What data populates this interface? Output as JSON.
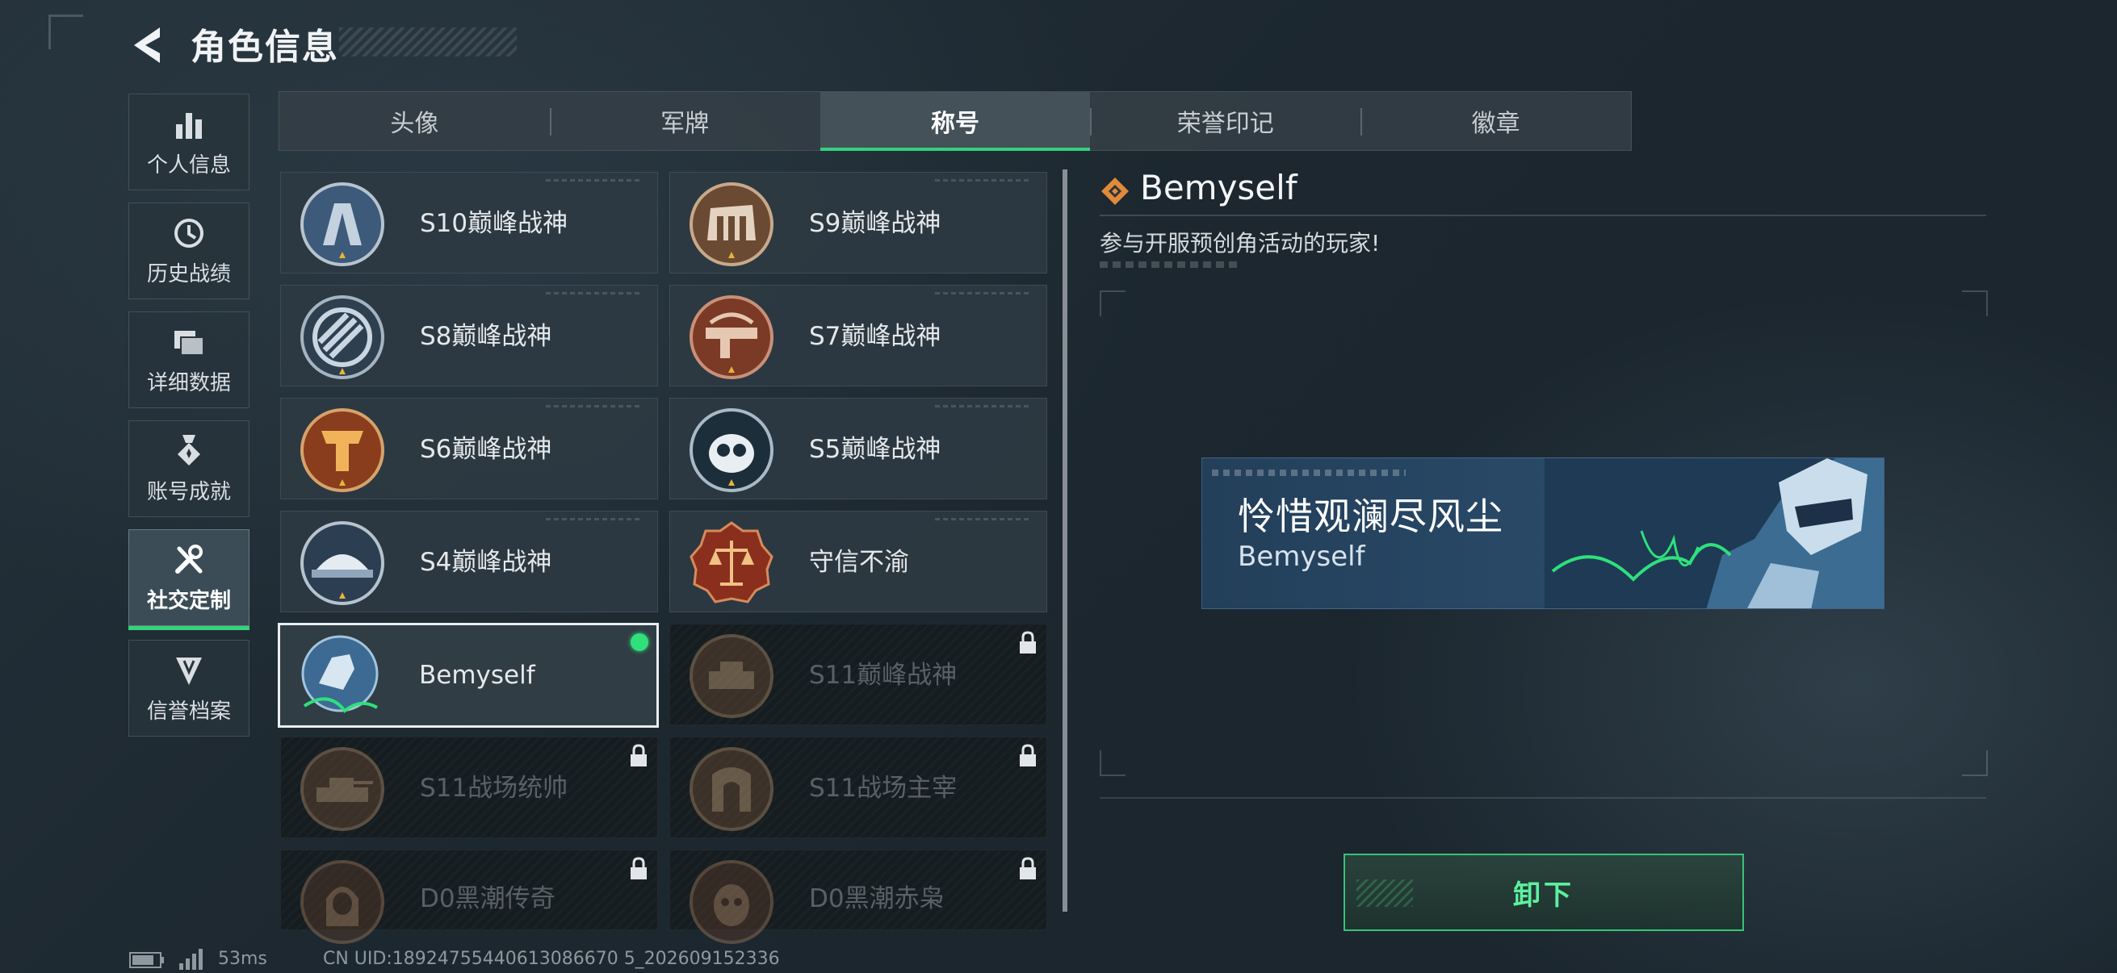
{
  "header": {
    "title": "角色信息"
  },
  "sidebar": {
    "items": [
      {
        "label": "个人信息",
        "icon": "bar-chart-icon",
        "active": false
      },
      {
        "label": "历史战绩",
        "icon": "clock-history-icon",
        "active": false
      },
      {
        "label": "详细数据",
        "icon": "folder-icon",
        "active": false
      },
      {
        "label": "账号成就",
        "icon": "medal-icon",
        "active": false
      },
      {
        "label": "社交定制",
        "icon": "tools-icon",
        "active": true
      },
      {
        "label": "信誉档案",
        "icon": "shield-icon",
        "active": false
      }
    ]
  },
  "tabs": [
    {
      "label": "头像",
      "active": false
    },
    {
      "label": "军牌",
      "active": false
    },
    {
      "label": "称号",
      "active": true
    },
    {
      "label": "荣誉印记",
      "active": false
    },
    {
      "label": "徽章",
      "active": false
    }
  ],
  "titles": [
    {
      "label": "S10巅峰战神",
      "icon": "s10-peak-badge-icon",
      "locked": false,
      "equipped": false
    },
    {
      "label": "S9巅峰战神",
      "icon": "s9-peak-badge-icon",
      "locked": false,
      "equipped": false
    },
    {
      "label": "S8巅峰战神",
      "icon": "s8-peak-badge-icon",
      "locked": false,
      "equipped": false
    },
    {
      "label": "S7巅峰战神",
      "icon": "s7-peak-badge-icon",
      "locked": false,
      "equipped": false
    },
    {
      "label": "S6巅峰战神",
      "icon": "s6-peak-badge-icon",
      "locked": false,
      "equipped": false
    },
    {
      "label": "S5巅峰战神",
      "icon": "s5-peak-badge-icon",
      "locked": false,
      "equipped": false
    },
    {
      "label": "S4巅峰战神",
      "icon": "s4-peak-badge-icon",
      "locked": false,
      "equipped": false
    },
    {
      "label": "守信不渝",
      "icon": "scales-badge-icon",
      "locked": false,
      "equipped": false
    },
    {
      "label": "Bemyself",
      "icon": "bemyself-badge-icon",
      "locked": false,
      "equipped": true
    },
    {
      "label": "S11巅峰战神",
      "icon": "s11-peak-badge-icon",
      "locked": true,
      "equipped": false
    },
    {
      "label": "S11战场统帅",
      "icon": "s11-commander-badge-icon",
      "locked": true,
      "equipped": false
    },
    {
      "label": "S11战场主宰",
      "icon": "s11-dominator-badge-icon",
      "locked": true,
      "equipped": false
    },
    {
      "label": "D0黑潮传奇",
      "icon": "d0-legend-badge-icon",
      "locked": true,
      "equipped": false
    },
    {
      "label": "D0黑潮赤枭",
      "icon": "d0-owl-badge-icon",
      "locked": true,
      "equipped": false
    }
  ],
  "detail": {
    "name": "Bemyself",
    "description": "参与开服预创角活动的玩家!",
    "banner_title": "怜惜观澜尽风尘",
    "banner_subtitle": "Bemyself",
    "button_label": "卸下"
  },
  "status": {
    "ping": "53ms",
    "uid": "CN UID:18924755440613086670 5_202609152336"
  },
  "colors": {
    "accent_green": "#35d07c",
    "equipped_dot": "#2fe07b",
    "banner_blue": "#294a68"
  }
}
